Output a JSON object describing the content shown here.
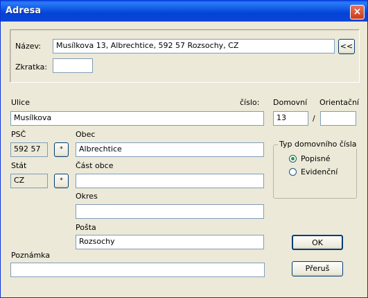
{
  "window": {
    "title": "Adresa",
    "close_label": "×"
  },
  "top": {
    "nazev_label": "Název:",
    "nazev_value": "Musílkova 13, Albrechtice, 592 57 Rozsochy, CZ",
    "copy_button": "<<",
    "zkratka_label": "Zkratka:",
    "zkratka_value": ""
  },
  "address": {
    "ulice_label": "Ulice",
    "cislo_label": "číslo:",
    "domovni_label": "Domovní",
    "orientacni_label": "Orientační",
    "ulice_value": "Musílkova",
    "domovni_value": "13",
    "slash": "/",
    "orientacni_value": "",
    "psc_label": "PSČ",
    "psc_value": "592 57",
    "psc_button": "*",
    "obec_label": "Obec",
    "obec_value": "Albrechtice",
    "stat_label": "Stát",
    "stat_value": "CZ",
    "stat_button": "*",
    "cast_obce_label": "Část obce",
    "cast_obce_value": "",
    "okres_label": "Okres",
    "okres_value": "",
    "posta_label": "Pošta",
    "posta_value": "Rozsochy",
    "poznamka_label": "Poznámka",
    "poznamka_value": ""
  },
  "typ": {
    "group_label": "Typ domovního čísla",
    "options": [
      {
        "label": "Popisné",
        "selected": true
      },
      {
        "label": "Evidenční",
        "selected": false
      }
    ]
  },
  "buttons": {
    "ok": "OK",
    "cancel": "Přeruš"
  }
}
